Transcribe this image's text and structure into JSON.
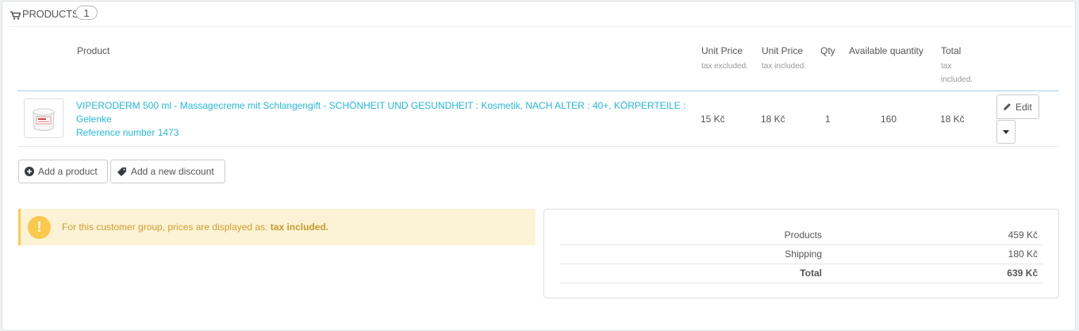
{
  "heading": {
    "title": "PRODUCTS",
    "count": "1"
  },
  "table": {
    "headers": {
      "product": "Product",
      "unit_price_excl": "Unit Price",
      "unit_price_excl_sub": "tax excluded.",
      "unit_price_incl": "Unit Price",
      "unit_price_incl_sub": "tax included.",
      "qty": "Qty",
      "available": "Available quantity",
      "total": "Total",
      "total_sub": "tax included."
    },
    "rows": [
      {
        "name": "VIPERODERM 500 ml - Massagecreme mit Schlangengift - SCHÖNHEIT UND GESUNDHEIT : Kosmetik, NACH ALTER   : 40+, KÖRPERTEILE : Gelenke",
        "reference": "Reference number 1473",
        "unit_price_excl": "15 Kč",
        "unit_price_incl": "18 Kč",
        "qty": "1",
        "available": "160",
        "total": "18 Kč",
        "edit_label": "Edit"
      }
    ]
  },
  "actions": {
    "add_product": "Add a product",
    "add_discount": "Add a new discount"
  },
  "alert": {
    "text": "For this customer group, prices are displayed as: ",
    "emphasis": "tax included."
  },
  "totals": [
    {
      "label": "Products",
      "value": "459 Kč"
    },
    {
      "label": "Shipping",
      "value": "180 Kč"
    },
    {
      "label": "Total",
      "value": "639 Kč"
    }
  ]
}
